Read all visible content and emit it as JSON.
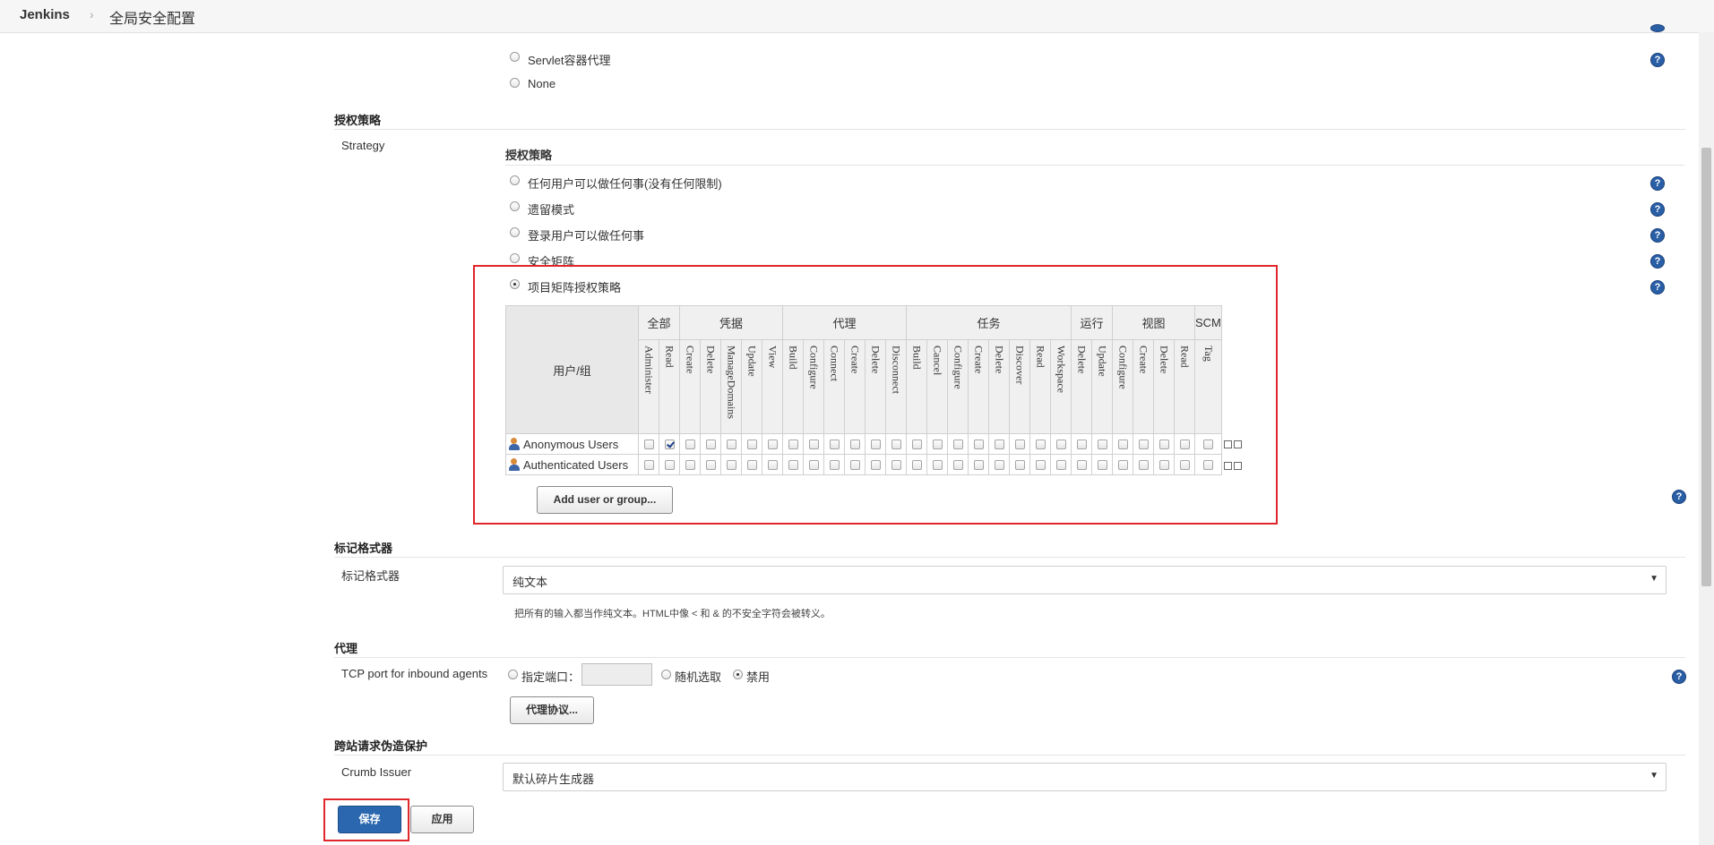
{
  "breadcrumb": {
    "root": "Jenkins",
    "separator": "›",
    "page": "全局安全配置"
  },
  "security_realm_options": [
    "Servlet容器代理",
    "None"
  ],
  "authorization": {
    "section_title": "授权策略",
    "strategy_label": "Strategy",
    "sub_title": "授权策略",
    "options": [
      "任何用户可以做任何事(没有任何限制)",
      "遗留模式",
      "登录用户可以做任何事",
      "安全矩阵",
      "项目矩阵授权策略"
    ],
    "selected_option": "项目矩阵授权策略"
  },
  "matrix": {
    "user_header": "用户/组",
    "groups": [
      {
        "label": "全部",
        "permissions": [
          "Administer",
          "Read"
        ]
      },
      {
        "label": "凭据",
        "permissions": [
          "Create",
          "Delete",
          "ManageDomains",
          "Update",
          "View"
        ]
      },
      {
        "label": "代理",
        "permissions": [
          "Build",
          "Configure",
          "Connect",
          "Create",
          "Delete",
          "Disconnect"
        ]
      },
      {
        "label": "任务",
        "permissions": [
          "Build",
          "Cancel",
          "Configure",
          "Create",
          "Delete",
          "Discover",
          "Read",
          "Workspace"
        ]
      },
      {
        "label": "运行",
        "permissions": [
          "Delete",
          "Update"
        ]
      },
      {
        "label": "视图",
        "permissions": [
          "Configure",
          "Create",
          "Delete",
          "Read"
        ]
      },
      {
        "label": "SCM",
        "permissions": [
          "Tag"
        ]
      }
    ],
    "rows": [
      {
        "name": "Anonymous Users",
        "checked": [
          1
        ]
      },
      {
        "name": "Authenticated Users",
        "checked": []
      }
    ],
    "add_button": "Add user or group..."
  },
  "markup": {
    "section_title": "标记格式器",
    "field_label": "标记格式器",
    "selected": "纯文本",
    "description": "把所有的输入都当作纯文本。HTML中像 < 和 & 的不安全字符会被转义。"
  },
  "agents": {
    "section_title": "代理",
    "port_label": "TCP port for inbound agents",
    "option_fixed": "指定端口：",
    "option_random": "随机选取",
    "option_disable": "禁用",
    "selected_option": "禁用",
    "port_value": "",
    "protocols_button": "代理协议..."
  },
  "csrf": {
    "section_title": "跨站请求伪造保护",
    "issuer_label": "Crumb Issuer",
    "issuer_selected": "默认碎片生成器"
  },
  "footer": {
    "save": "保存",
    "apply": "应用"
  },
  "help_icon_text": "?",
  "colors": {
    "highlight": "#e0262b",
    "primary": "#2a67ae",
    "help": "#2a5fa6"
  }
}
